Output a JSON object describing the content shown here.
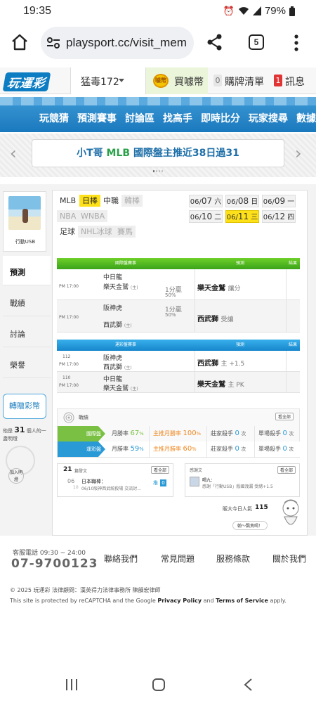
{
  "status_bar": {
    "time": "19:35",
    "battery": "79%"
  },
  "browser": {
    "url": "playsport.cc/visit_mem",
    "tab_count": "5"
  },
  "site_header": {
    "logo": "玩運彩",
    "username": "猛毒172",
    "buy_coins": "買噱幣",
    "coin_icon_text": "噱幣",
    "purchase_list_count": "0",
    "purchase_list": "購牌清單",
    "messages_count": "1",
    "messages": "訊息"
  },
  "nav": {
    "items": [
      "玩競猜",
      "預測賽事",
      "討論區",
      "找高手",
      "即時比分",
      "玩家搜尋",
      "數據"
    ]
  },
  "banner": {
    "text_prefix": "小T哥",
    "text_league": "MLB",
    "text_suffix": "國際盤主推近38日過31"
  },
  "profile": {
    "name": "行動USB"
  },
  "side_tabs": [
    "預測",
    "戰績",
    "討論",
    "榮譽"
  ],
  "gift_button": "轉贈彩幣",
  "praise": {
    "prefix": "他是",
    "count": "31",
    "suffix": "個人的一盞明燈",
    "add": "加入明燈"
  },
  "leagues": {
    "row1": [
      "MLB",
      "日棒",
      "中職",
      "韓棒"
    ],
    "row2": [
      "NBA",
      "WNBA"
    ],
    "row3": [
      "足球",
      "NHL冰球",
      "賽馬"
    ],
    "active": "日棒",
    "disabled": [
      "韓棒",
      "NBA",
      "WNBA",
      "NHL冰球",
      "賽馬"
    ]
  },
  "dates": [
    {
      "md": "06/",
      "d": "07",
      "w": "六"
    },
    {
      "md": "06/",
      "d": "08",
      "w": "日"
    },
    {
      "md": "06/",
      "d": "09",
      "w": "一"
    },
    {
      "md": "06/",
      "d": "10",
      "w": "二"
    },
    {
      "md": "06/",
      "d": "11",
      "w": "三"
    },
    {
      "md": "06/",
      "d": "12",
      "w": "四"
    }
  ],
  "intl": {
    "header": {
      "game": "國際盤賽事",
      "pick": "預測",
      "result": "結果"
    },
    "rows": [
      {
        "time": "PM 17:00",
        "away": "中日龍",
        "home": "樂天金鷲",
        "home_mark": "(主)",
        "line": "1分贏",
        "pct": "50",
        "pick": "樂天金鷲",
        "pick_note": "讓分"
      },
      {
        "time": "PM 17:00",
        "away": "阪神虎",
        "home": "西武獅",
        "home_mark": "(主)",
        "line": "1分贏",
        "pct": "50",
        "pick": "西武獅",
        "pick_note": "受讓"
      }
    ]
  },
  "local": {
    "header": {
      "game": "運彩盤賽事",
      "pick": "預測",
      "result": "結果"
    },
    "rows": [
      {
        "num": "112",
        "time": "PM 17:00",
        "away": "阪神虎",
        "home": "西武獅",
        "home_mark": "(主)",
        "pick": "西武獅",
        "pick_note": "主 +1.5"
      },
      {
        "num": "110",
        "time": "PM 17:00",
        "away": "中日龍",
        "home": "樂天金鷲",
        "home_mark": "(主)",
        "pick": "樂天金鷲",
        "pick_note": "主 PK"
      }
    ]
  },
  "stats": {
    "title": "戰績",
    "see_all": "看全部",
    "rows": [
      {
        "label": "國際盤",
        "color": "#7ac143",
        "month_label": "月勝率",
        "month": "67",
        "main_label": "主推月勝率",
        "main": "100",
        "streak_label": "莊家殺手",
        "streak": "0",
        "single_label": "單場殺手",
        "single": "0",
        "unit_pct": "%",
        "unit_times": "次"
      },
      {
        "label": "運彩盤",
        "color": "#2a9ad6",
        "month_label": "月勝率",
        "month": "59",
        "main_label": "主推月勝率",
        "main": "60",
        "streak_label": "莊家殺手",
        "streak": "0",
        "single_label": "單場殺手",
        "single": "0",
        "unit_pct": "%",
        "unit_times": "次"
      }
    ]
  },
  "posts": {
    "count": "21",
    "label": "篇發文",
    "see_all": "看全部",
    "date_m": "06",
    "date_d": "10",
    "title": "日本職棒：",
    "excerpt": "06/10阪神西武統殺場 交流討...",
    "reply": "推",
    "reply_count": "0"
  },
  "thanks": {
    "label": "感謝文",
    "see_all": "看全部",
    "user": "喝九：",
    "text": "感謝「行動USB」殺國洩漏 受總+1.5"
  },
  "popularity": {
    "label": "販大今日人氣",
    "value": "115",
    "bubble": "翰～飄責喝！"
  },
  "footer": {
    "phone_label": "客服電話 09:30 ~ 24:00",
    "phone": "07-9700123",
    "links": [
      "聯絡我們",
      "常見問題",
      "服務條款",
      "關於我們"
    ],
    "copyright": "© 2025 玩運彩  法律顧問：漢英得力法律事務所 陳韻宏律師",
    "recaptcha_pre": "This site is protected by reCAPTCHA and the Google ",
    "privacy": "Privacy Policy",
    "and": " and ",
    "terms": "Terms of Service",
    "recaptcha_post": " apply."
  }
}
